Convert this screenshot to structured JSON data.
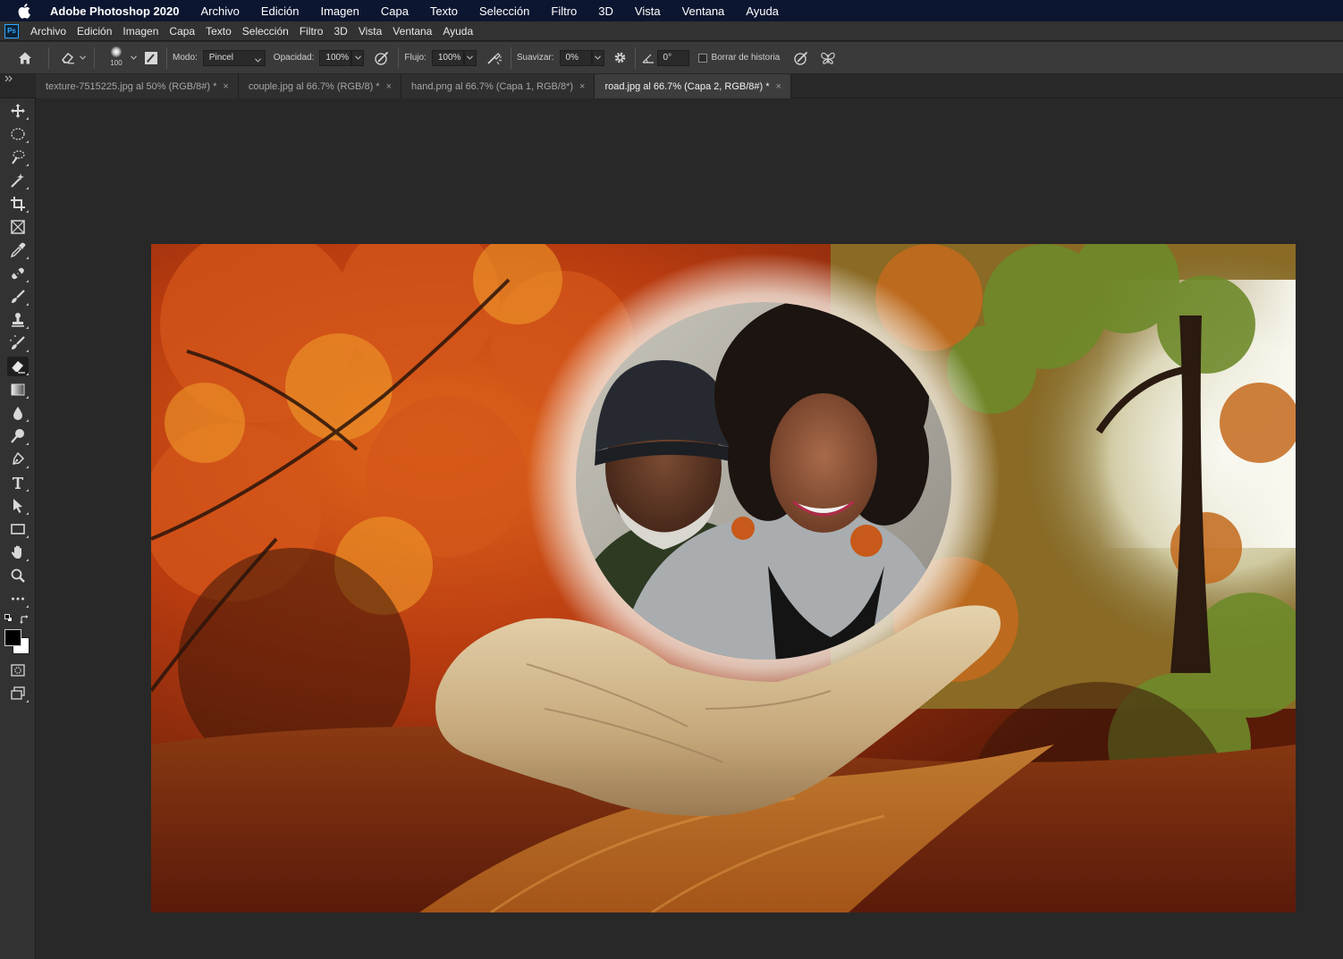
{
  "mac_menubar": {
    "app_name": "Adobe Photoshop 2020",
    "items": [
      "Archivo",
      "Edición",
      "Imagen",
      "Capa",
      "Texto",
      "Selección",
      "Filtro",
      "3D",
      "Vista",
      "Ventana",
      "Ayuda"
    ]
  },
  "ps_menubar": {
    "logo": "Ps",
    "items": [
      "Archivo",
      "Edición",
      "Imagen",
      "Capa",
      "Texto",
      "Selección",
      "Filtro",
      "3D",
      "Vista",
      "Ventana",
      "Ayuda"
    ]
  },
  "options_bar": {
    "brush_size": "100",
    "mode_label": "Modo:",
    "mode_value": "Pincel",
    "opacity_label": "Opacidad:",
    "opacity_value": "100%",
    "flow_label": "Flujo:",
    "flow_value": "100%",
    "smoothing_label": "Suavizar:",
    "smoothing_value": "0%",
    "angle_value": "0°",
    "erase_history_label": "Borrar de historia",
    "erase_history_checked": false
  },
  "tabs": [
    {
      "label": "texture-7515225.jpg al 50% (RGB/8#) *",
      "active": false
    },
    {
      "label": "couple.jpg al 66.7% (RGB/8) *",
      "active": false
    },
    {
      "label": "hand.png al 66.7% (Capa 1, RGB/8*)",
      "active": false
    },
    {
      "label": "road.jpg al 66.7% (Capa 2, RGB/8#) *",
      "active": true
    }
  ],
  "tab_close_glyph": "×",
  "toolbar": {
    "active_tool": "eraser",
    "tools": [
      "move",
      "lasso",
      "quick-selection",
      "magic-wand",
      "crop",
      "frame",
      "eyedropper",
      "healing-brush",
      "brush",
      "clone-stamp",
      "history-brush",
      "eraser",
      "gradient",
      "blur",
      "dodge",
      "pen",
      "type",
      "path-selection",
      "rectangle",
      "hand",
      "zoom",
      "more"
    ],
    "foreground_color": "#000000",
    "background_color": "#ffffff"
  },
  "colors": {
    "accent_ps": "#31a8ff",
    "workspace": "#282828",
    "panel": "#323232"
  }
}
